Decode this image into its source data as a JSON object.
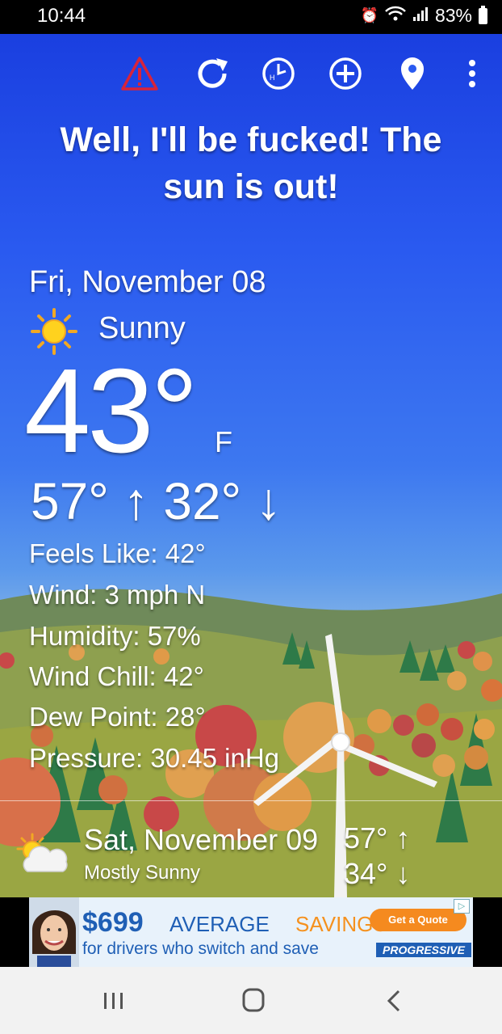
{
  "status_bar": {
    "time": "10:44",
    "battery": "83%"
  },
  "toolbar": {
    "icons": [
      "alert-icon",
      "refresh-icon",
      "clock-icon",
      "add-icon",
      "location-icon",
      "more-icon"
    ]
  },
  "headline": "Well, I'll be fucked! The sun is out!",
  "current": {
    "date": "Fri, November 08",
    "condition": "Sunny",
    "temperature": "43°",
    "unit": "F",
    "high_low": "57° ↑ 32° ↓",
    "feels_like": "Feels Like: 42°",
    "wind": "Wind: 3 mph N",
    "humidity": "Humidity: 57%",
    "wind_chill": "Wind Chill: 42°",
    "dew_point": "Dew Point: 28°",
    "pressure": "Pressure: 30.45 inHg"
  },
  "forecast": [
    {
      "date": "Sat, November 09",
      "condition": "Mostly Sunny",
      "high": "57° ↑",
      "low": "34° ↓"
    }
  ],
  "ad": {
    "price": "$699",
    "average": "AVERAGE",
    "savings": "SAVINGS",
    "line2": "for drivers who switch and save",
    "cta": "Get a Quote",
    "brand": "PROGRESSIVE"
  },
  "colors": {
    "sky_top": "#1a3fe0",
    "alert": "#d8233a",
    "ad_blue": "#1f5fb5",
    "ad_orange": "#f58a1f"
  }
}
